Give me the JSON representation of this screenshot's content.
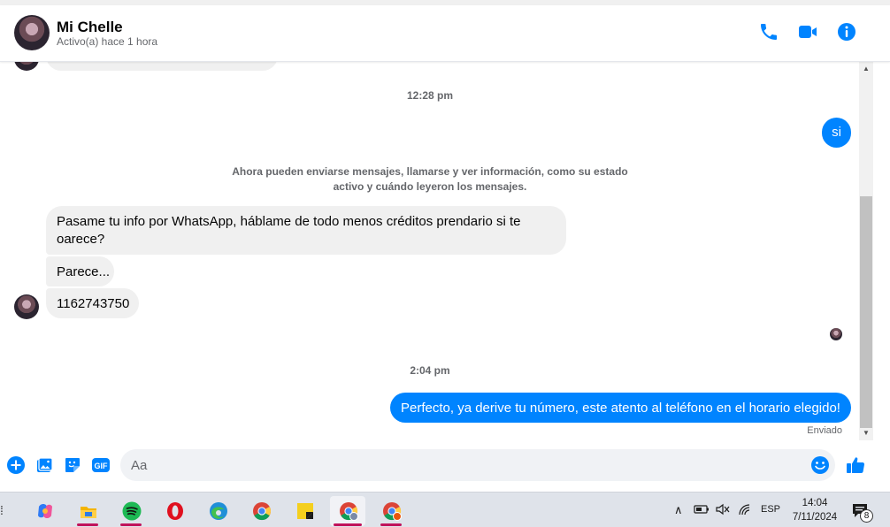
{
  "header": {
    "name": "Mi Chelle",
    "status": "Activo(a) hace 1 hora",
    "accent_color": "#0084ff"
  },
  "messages": {
    "timestamp_1": "12:28 pm",
    "outgoing_1": "si",
    "system_line_1": "Ahora pueden enviarse mensajes, llamarse y ver información, como su estado",
    "system_line_2": "activo y cuándo leyeron los mensajes.",
    "incoming_1_line_1": "Pasame tu info por WhatsApp, háblame de todo menos créditos prendario si te",
    "incoming_1_line_2": "oarece?",
    "incoming_2": "Parece...",
    "incoming_3": "1162743750",
    "timestamp_2": "2:04 pm",
    "outgoing_2": "Perfecto, ya derive tu número, este atento al teléfono en el horario elegido!",
    "delivery_status": "Enviado"
  },
  "composer": {
    "placeholder": "Aa",
    "gif_label": "GIF"
  },
  "taskbar": {
    "language": "ESP",
    "time": "14:04",
    "date": "7/11/2024",
    "notification_count": "8",
    "apps": [
      "copilot-icon",
      "file-explorer-icon",
      "spotify-icon",
      "opera-icon",
      "edge-icon",
      "chrome-icon",
      "sticky-notes-icon",
      "chrome-profile-icon",
      "chrome-profile-icon"
    ]
  }
}
